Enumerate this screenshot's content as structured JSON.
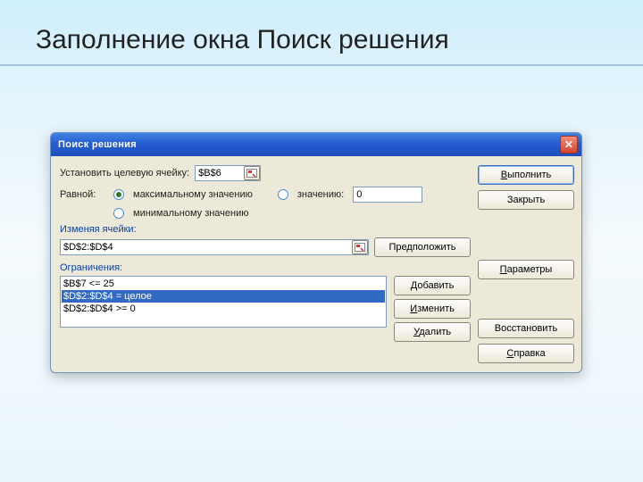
{
  "slide": {
    "title": "Заполнение окна Поиск решения"
  },
  "window": {
    "title": "Поиск решения"
  },
  "labels": {
    "target_cell": "Установить целевую ячейку:",
    "equal_to": "Равной:",
    "max": "максимальному значению",
    "min": "минимальному значению",
    "value": "значению:",
    "changing_cells": "Изменяя ячейки:",
    "constraints": "Ограничения:"
  },
  "fields": {
    "target_cell": "$B$6",
    "value_of": "0",
    "changing_cells": "$D$2:$D$4"
  },
  "constraints": [
    "$B$7 <= 25",
    "$D$2:$D$4 = целое",
    "$D$2:$D$4 >= 0"
  ],
  "constraints_selected_index": 1,
  "buttons": {
    "solve": "Выполнить",
    "close": "Закрыть",
    "guess": "Предположить",
    "options": "Параметры",
    "add": "Добавить",
    "change": "Изменить",
    "delete": "Удалить",
    "reset": "Восстановить",
    "help": "Справка"
  },
  "radio_selected": "max"
}
